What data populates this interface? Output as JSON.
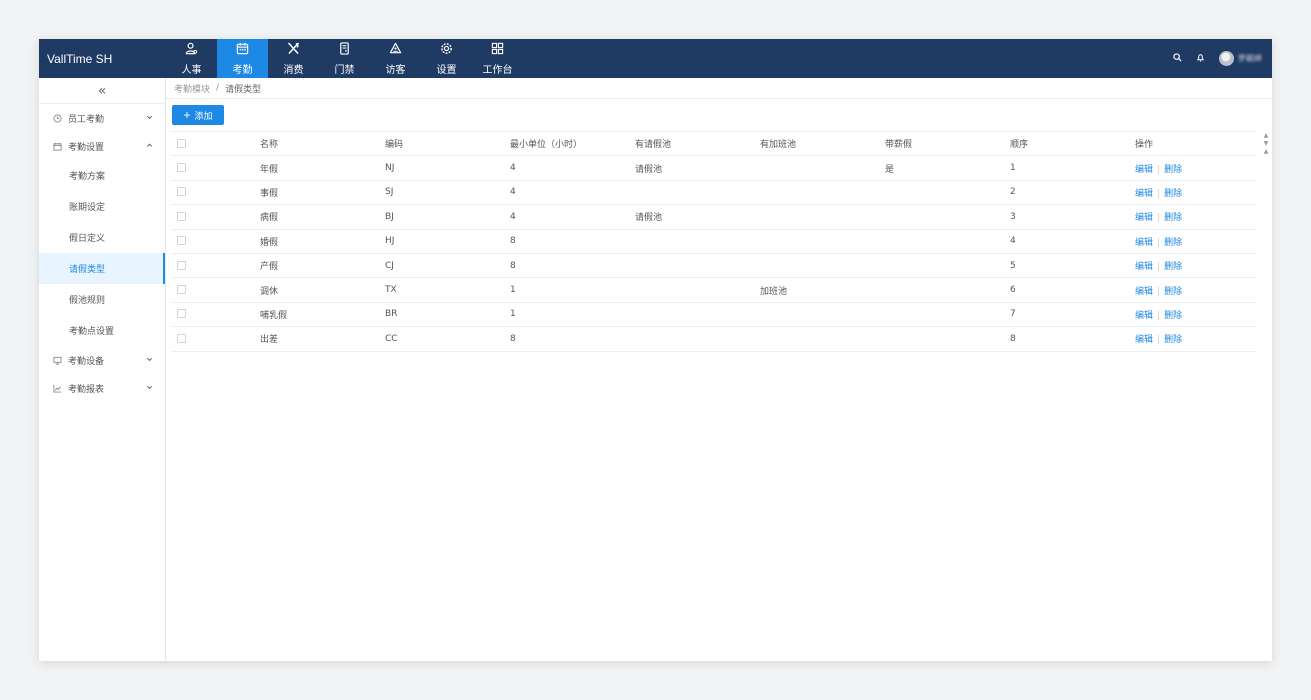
{
  "app": {
    "title": "VallTime SH"
  },
  "nav": [
    {
      "icon": "user-icon",
      "label": "人事"
    },
    {
      "icon": "calendar-icon",
      "label": "考勤"
    },
    {
      "icon": "fork-knife-icon",
      "label": "消费"
    },
    {
      "icon": "door-icon",
      "label": "门禁"
    },
    {
      "icon": "visitor-icon",
      "label": "访客"
    },
    {
      "icon": "gear-icon",
      "label": "设置"
    },
    {
      "icon": "grid-icon",
      "label": "工作台"
    }
  ],
  "active_nav": "考勤",
  "user": {
    "name": "罗颖婷"
  },
  "sidebar": {
    "collapse_icon": "«",
    "groups": {
      "employee": {
        "label": "员工考勤",
        "icon": "clock-icon"
      },
      "settings": {
        "label": "考勤设置",
        "icon": "calendar-settings-icon"
      },
      "devices": {
        "label": "考勤设备",
        "icon": "monitor-icon"
      },
      "reports": {
        "label": "考勤报表",
        "icon": "chart-icon"
      }
    },
    "settings_items": [
      "考勤方案",
      "账期设定",
      "假日定义",
      "请假类型",
      "假池规则",
      "考勤点设置"
    ],
    "active_item": "请假类型"
  },
  "breadcrumb": {
    "parent": "考勤模块",
    "separator": "/",
    "current": "请假类型"
  },
  "toolbar": {
    "add_label": "添加",
    "add_icon": "+"
  },
  "table": {
    "columns": [
      "名称",
      "编码",
      "最小单位（小时）",
      "有请假池",
      "有加班池",
      "带薪假",
      "顺序",
      "操作"
    ],
    "rows": [
      {
        "name": "年假",
        "code": "NJ",
        "min_unit": "4",
        "leave_pool": "请假池",
        "ot_pool": "",
        "paid": "是",
        "order": "1"
      },
      {
        "name": "事假",
        "code": "SJ",
        "min_unit": "4",
        "leave_pool": "",
        "ot_pool": "",
        "paid": "",
        "order": "2"
      },
      {
        "name": "病假",
        "code": "BJ",
        "min_unit": "4",
        "leave_pool": "请假池",
        "ot_pool": "",
        "paid": "",
        "order": "3"
      },
      {
        "name": "婚假",
        "code": "HJ",
        "min_unit": "8",
        "leave_pool": "",
        "ot_pool": "",
        "paid": "",
        "order": "4"
      },
      {
        "name": "产假",
        "code": "CJ",
        "min_unit": "8",
        "leave_pool": "",
        "ot_pool": "",
        "paid": "",
        "order": "5"
      },
      {
        "name": "调休",
        "code": "TX",
        "min_unit": "1",
        "leave_pool": "",
        "ot_pool": "加班池",
        "paid": "",
        "order": "6"
      },
      {
        "name": "哺乳假",
        "code": "BR",
        "min_unit": "1",
        "leave_pool": "",
        "ot_pool": "",
        "paid": "",
        "order": "7"
      },
      {
        "name": "出差",
        "code": "CC",
        "min_unit": "8",
        "leave_pool": "",
        "ot_pool": "",
        "paid": "",
        "order": "8"
      }
    ],
    "actions": {
      "edit": "编辑",
      "delete": "删除"
    }
  },
  "colors": {
    "topbar": "#1f3a63",
    "accent": "#1e88e5",
    "active_bg": "#e8f4ff"
  }
}
